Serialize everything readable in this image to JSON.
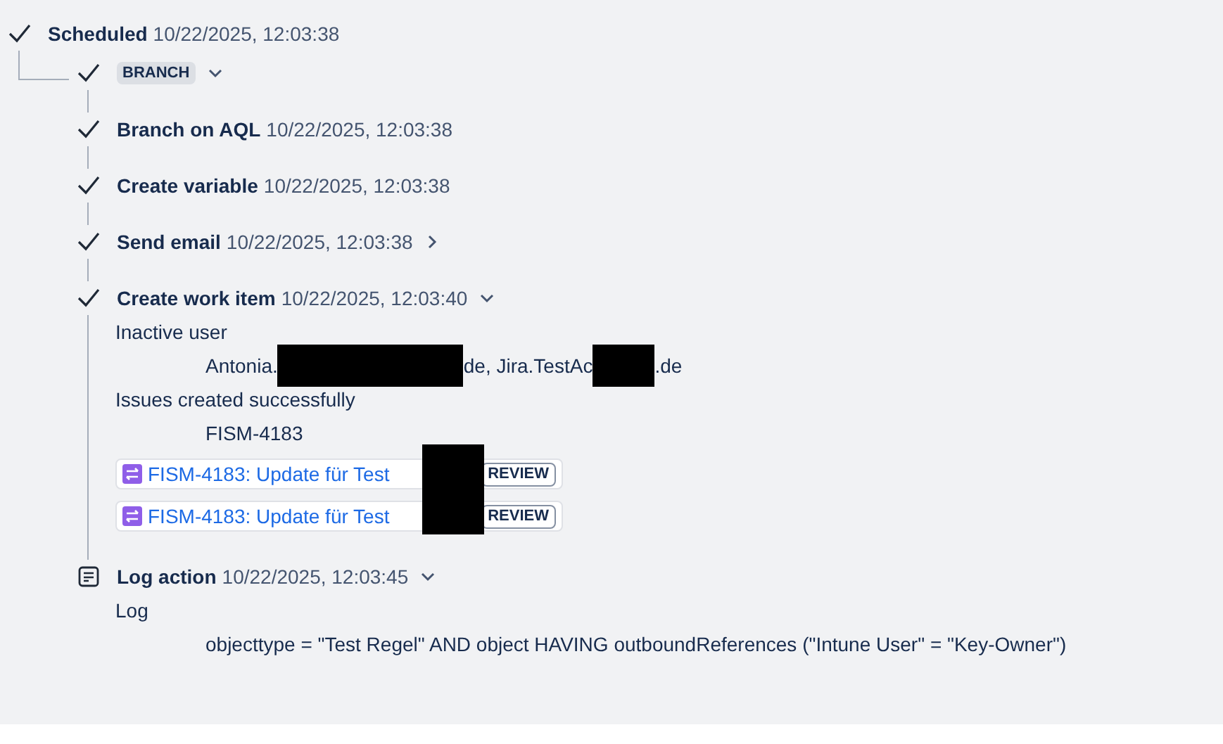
{
  "root": {
    "title": "Scheduled",
    "time": "10/22/2025, 12:03:38",
    "done": true
  },
  "branch": {
    "label": "BRANCH",
    "done": true,
    "expanded": true
  },
  "steps": [
    {
      "kind": "check",
      "title": "Branch on AQL",
      "time": "10/22/2025, 12:03:38"
    },
    {
      "kind": "check",
      "title": "Create variable",
      "time": "10/22/2025, 12:03:38"
    },
    {
      "kind": "check",
      "title": "Send email",
      "time": "10/22/2025, 12:03:38",
      "expanded": false
    },
    {
      "kind": "check",
      "title": "Create work item",
      "time": "10/22/2025, 12:03:40",
      "expanded": true,
      "details": [
        {
          "kind": "label",
          "text": "Inactive user"
        },
        {
          "kind": "value",
          "parts": [
            {
              "text": "Antonia."
            },
            {
              "kind": "redaction"
            },
            {
              "text": "de, Jira.TestAc"
            },
            {
              "kind": "redaction"
            },
            {
              "text": ".de"
            }
          ]
        },
        {
          "kind": "label",
          "text": "Issues created successfully"
        },
        {
          "kind": "value",
          "parts": [
            {
              "text": "FISM-4183"
            }
          ]
        },
        {
          "kind": "links",
          "items": [
            {
              "text": "FISM-4183: Update für Test",
              "status": "REVIEW"
            },
            {
              "text": "FISM-4183: Update für Test",
              "status": "REVIEW"
            }
          ]
        }
      ]
    },
    {
      "kind": "log",
      "title": "Log action",
      "time": "10/22/2025, 12:03:45",
      "expanded": true,
      "details": [
        {
          "kind": "label",
          "text": "Log"
        },
        {
          "kind": "value",
          "parts": [
            {
              "text": "objecttype = \"Test Regel\" AND object HAVING outboundReferences (\"Intune User\" = \"Key-Owner\")"
            }
          ]
        }
      ]
    }
  ]
}
